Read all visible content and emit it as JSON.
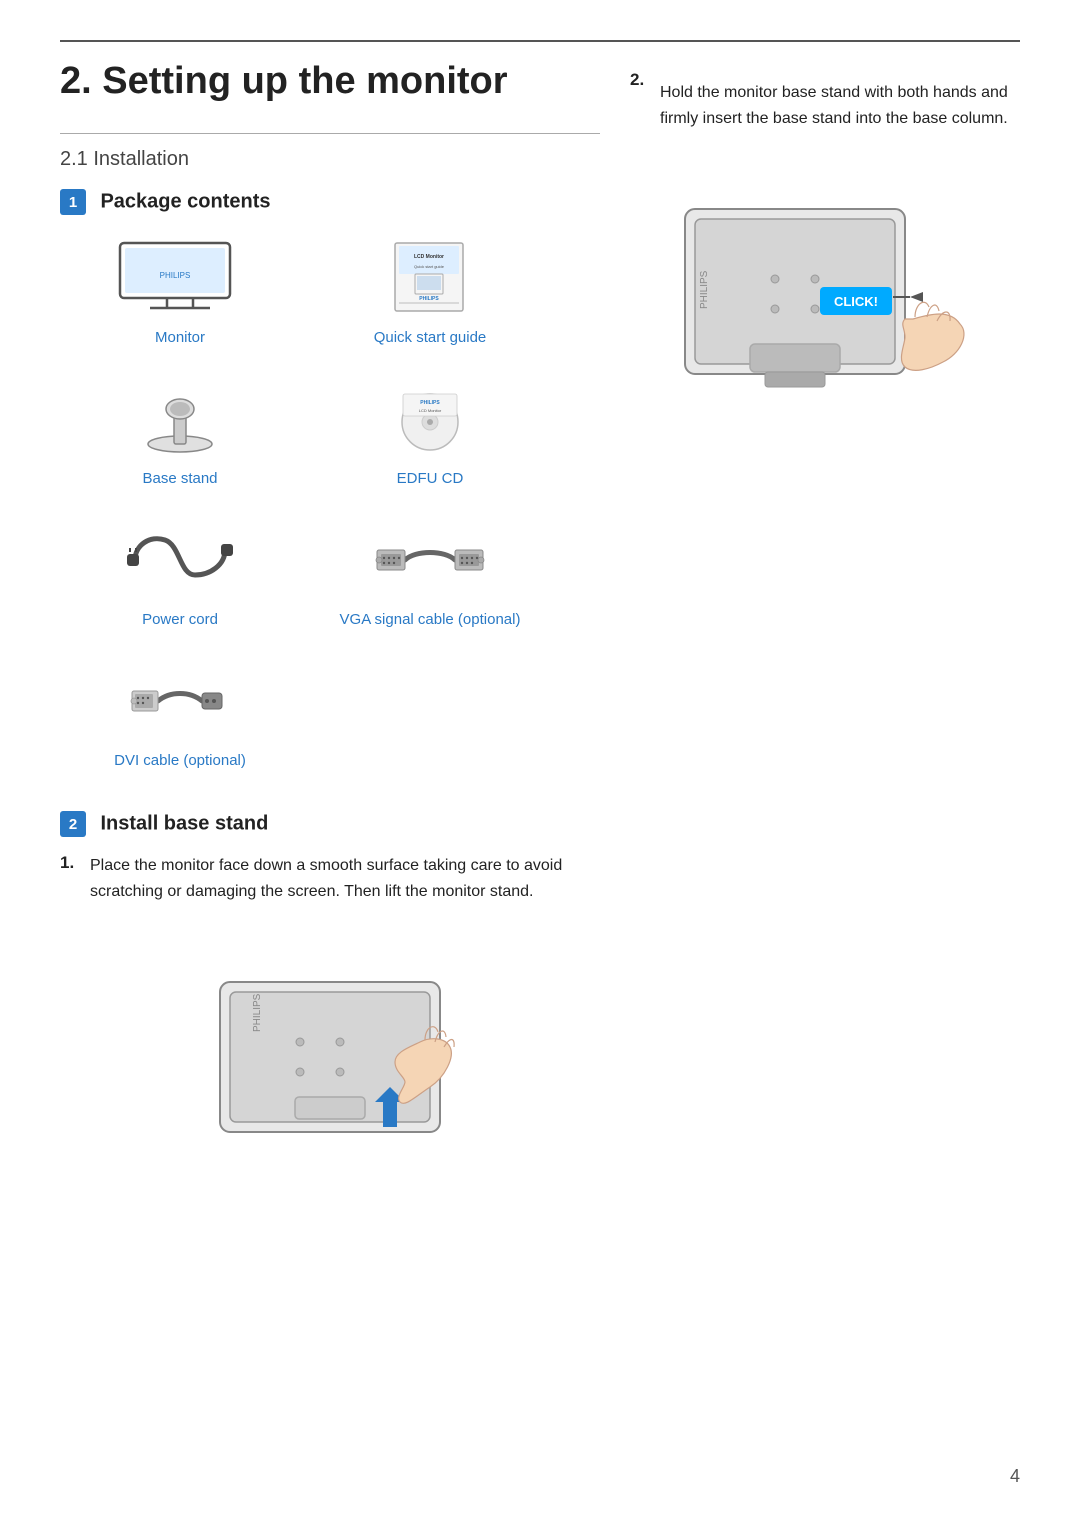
{
  "page": {
    "number": "4",
    "top_rule": true
  },
  "section": {
    "number": "2",
    "title": "Setting up the monitor"
  },
  "subsection": {
    "number": "2.1",
    "title": "Installation"
  },
  "step1": {
    "badge": "1",
    "label": "Package contents"
  },
  "items": [
    {
      "id": "monitor",
      "label": "Monitor"
    },
    {
      "id": "quick-start-guide",
      "label": "Quick start guide"
    },
    {
      "id": "base-stand",
      "label": "Base stand"
    },
    {
      "id": "edfu-cd",
      "label": "EDFU CD"
    },
    {
      "id": "power-cord",
      "label": "Power cord"
    },
    {
      "id": "vga-cable",
      "label": "VGA signal cable (optional)"
    },
    {
      "id": "dvi-cable",
      "label": "DVI cable (optional)"
    }
  ],
  "step2": {
    "badge": "2",
    "label": "Install base stand"
  },
  "instruction1": {
    "number": "1.",
    "text": "Place the monitor face down a smooth surface taking care to avoid scratching or damaging the screen. Then lift the monitor stand."
  },
  "instruction2": {
    "number": "2.",
    "text": "Hold the monitor base stand with both hands and firmly insert the base stand into the base column."
  },
  "click_label": "CLICK!"
}
